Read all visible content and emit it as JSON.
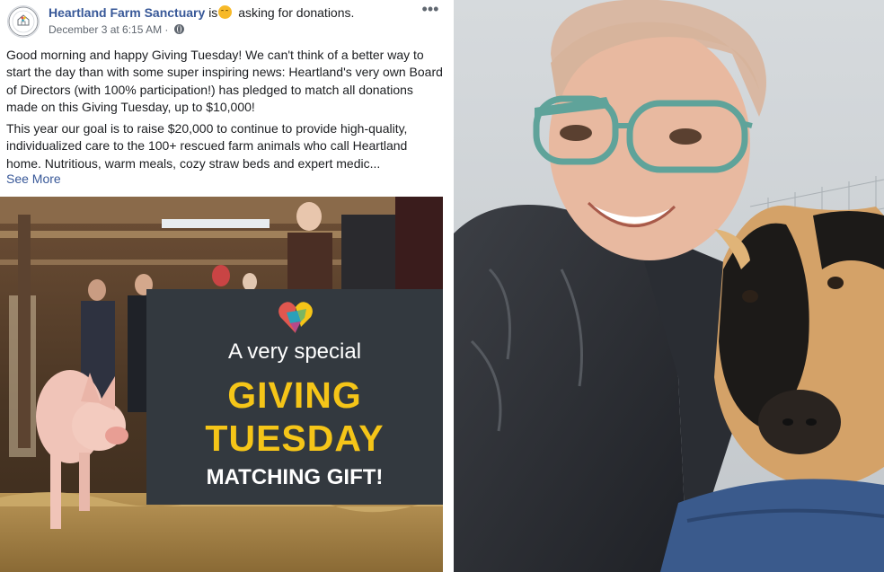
{
  "post": {
    "page_name": "Heartland Farm Sanctuary",
    "status_is": "is",
    "status_activity": "asking for donations.",
    "feeling_icon": "smiling-face-icon",
    "timestamp": "December 3 at 6:15 AM",
    "separator": "·",
    "privacy_icon": "globe-icon",
    "more_label": "•••",
    "paragraph1": "Good morning and happy Giving Tuesday! We can't think of a better way to start the day than with some super inspiring news: Heartland's very own Board of Directors (with 100% participation!) has pledged to match all donations made on this Giving Tuesday, up to $10,000!",
    "paragraph2": "This year our goal is to raise $20,000 to continue to provide high-quality, individualized care to the 100+ rescued farm animals who call Heartland home. Nutritious, warm meals, cozy straw beds and expert medic...",
    "see_more": "See More"
  },
  "promo": {
    "line1": "A very special",
    "line2": "GIVING",
    "line3": "TUESDAY",
    "line4": "MATCHING GIFT!",
    "accent_color": "#f5c518",
    "card_color": "#33393f"
  },
  "avatar": {
    "top_text": "HEARTLAND",
    "bottom_text": "SANCTUARY"
  },
  "colors": {
    "link": "#385898",
    "text": "#1c1e21",
    "muted": "#606770"
  }
}
